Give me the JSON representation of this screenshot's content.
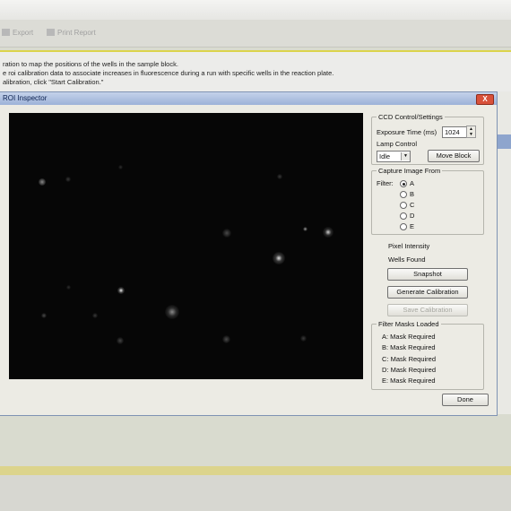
{
  "toolbar": {
    "item1": "Export",
    "item2": "Print Report"
  },
  "instructions": {
    "line1": "ration to map the positions of the wells in the sample block.",
    "line2": "e roi calibration data to associate increases in fluorescence during a run with specific wells in the reaction plate.",
    "line3": "alibration, click \"Start Calibration.\""
  },
  "dialog": {
    "title": "ROI Inspector",
    "close_label": "X"
  },
  "ccd": {
    "group_label": "CCD Control/Settings",
    "exposure_label": "Exposure Time (ms)",
    "exposure_value": "1024",
    "lamp_label": "Lamp Control",
    "lamp_value": "Idle",
    "move_block_label": "Move Block"
  },
  "capture": {
    "group_label": "Capture Image From",
    "filter_label": "Filter:",
    "options": [
      "A",
      "B",
      "C",
      "D",
      "E"
    ],
    "selected": "A"
  },
  "status": {
    "pixel_intensity": "Pixel Intensity",
    "wells_found": "Wells Found"
  },
  "buttons": {
    "snapshot": "Snapshot",
    "generate_calibration": "Generate Calibration",
    "save_calibration": "Save Calibration",
    "done": "Done"
  },
  "masks": {
    "group_label": "Filter Masks Loaded",
    "items": [
      "A: Mask Required",
      "B: Mask Required",
      "C: Mask Required",
      "D: Mask Required",
      "E: Mask Required"
    ]
  },
  "colors": {
    "accent": "#dcd44c",
    "titlebar": "#9db2d8",
    "close": "#d8513a"
  }
}
